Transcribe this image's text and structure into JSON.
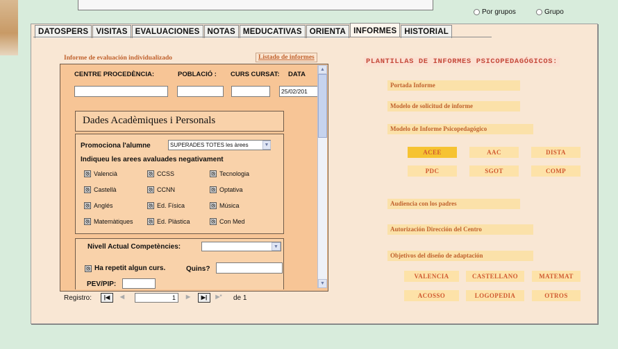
{
  "top": {
    "radio1_label": "Por grupos",
    "radio2_label": "Grupo"
  },
  "tabs": [
    {
      "label": "DATOSPERS"
    },
    {
      "label": "VISITAS"
    },
    {
      "label": "EVALUACIONES"
    },
    {
      "label": "NOTAS"
    },
    {
      "label": "MEDUCATIVAS"
    },
    {
      "label": "ORIENTA"
    },
    {
      "label": "INFORMES"
    },
    {
      "label": "HISTORIAL"
    }
  ],
  "form": {
    "title": "Informe de evaluación individualizado",
    "link_label": "Listado de informes",
    "col1": "CENTRE PROCEDÈNCIA:",
    "col2": "POBLACIÓ :",
    "col3": "CURS CURSAT:",
    "col4": "DATA",
    "date_value": "25/02/201",
    "section_title": "Dades Acadèmiques i Personals",
    "promociona_label": "Promociona l'alumne",
    "promociona_value": "SUPERADES TOTES les àrees",
    "areas_label": "Indiqueu les arees avaluades negativament",
    "checkboxes": [
      [
        "Valencià",
        "CCSS",
        "Tecnologia"
      ],
      [
        "Castellà",
        "CCNN",
        "Optativa"
      ],
      [
        "Anglés",
        "Ed. Física",
        "Música"
      ],
      [
        "Matemàtiques",
        "Ed. Plàstica",
        "Con Med"
      ]
    ],
    "nivell_label": "Nivell Actual Competències:",
    "repetit_label": "Ha repetit algun curs.",
    "quins_label": "Quins?",
    "pev_label": "PEV/PIP:"
  },
  "record_nav": {
    "label": "Registro:",
    "first": "|◀",
    "prev": "◀",
    "value": "1",
    "next": "▶",
    "last": "▶|",
    "new": "▶*",
    "of": "de 1"
  },
  "right": {
    "heading": "PLANTILLAS DE INFORMES PSICOPEDAGÓGICOS:",
    "links": [
      "Portada Informe",
      "Modelo de solicitud de informe",
      "Modelo de Informe Psicopedagógico"
    ],
    "buttons_row1": [
      "ACEE",
      "AAC",
      "DISTA"
    ],
    "buttons_row2": [
      "PDC",
      "SGOT",
      "COMP"
    ],
    "links2": [
      "Audiencia con los padres",
      "Autorización Dirección del Centro"
    ],
    "objetivos": "Objetivos del diseño de adaptación",
    "obj_row1": [
      "VALENCIA",
      "CASTELLANO",
      "MATEMAT"
    ],
    "obj_row2": [
      "ACOSSO",
      "LOGOPEDIA",
      "OTROS"
    ]
  },
  "colors": {
    "panel": "#f7c596",
    "window": "#f9e7d4",
    "accent_text": "#c0622e",
    "selected_button": "#f6c332"
  }
}
